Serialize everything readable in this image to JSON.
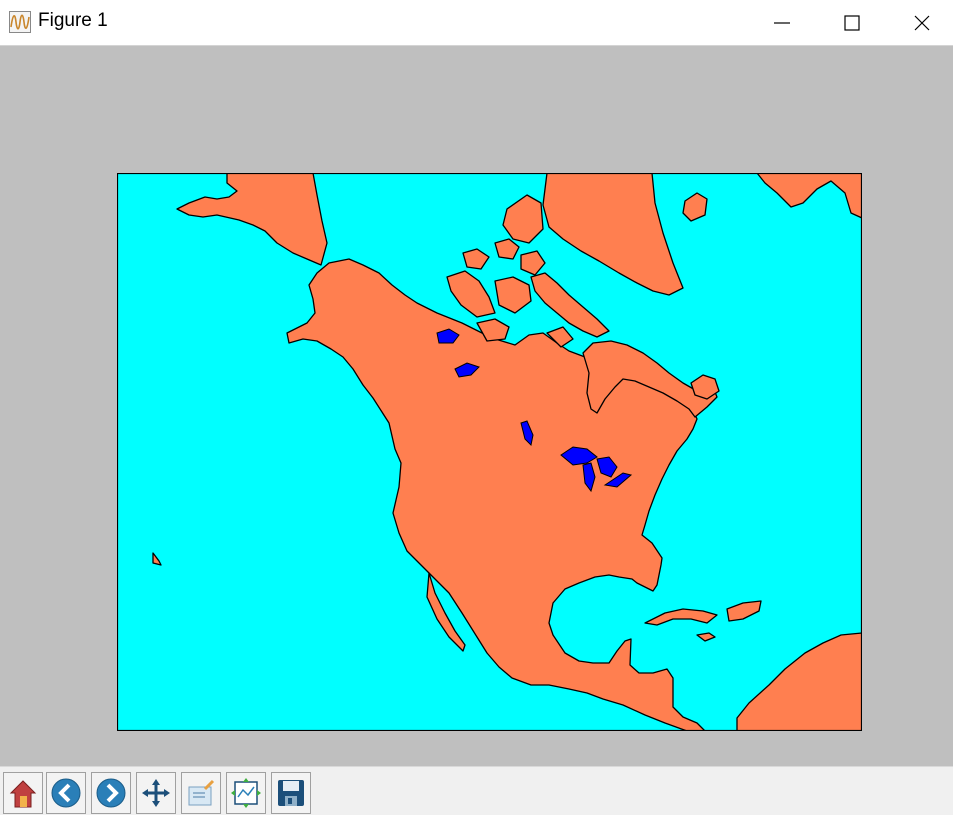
{
  "window": {
    "title": "Figure 1",
    "controls": [
      "minimize",
      "maximize",
      "close"
    ]
  },
  "figure": {
    "background_color": "#bfbfbf",
    "map": {
      "projection": "north-america-basemap",
      "ocean_color": "#00ffff",
      "land_color": "#ff7f50",
      "lake_color": "#0000ff",
      "coastline_color": "#000000"
    }
  },
  "toolbar": {
    "buttons": [
      {
        "name": "home",
        "icon": "home-icon"
      },
      {
        "name": "back",
        "icon": "back-arrow-icon"
      },
      {
        "name": "forward",
        "icon": "forward-arrow-icon"
      },
      {
        "name": "pan",
        "icon": "pan-arrows-icon"
      },
      {
        "name": "zoom",
        "icon": "zoom-rect-icon"
      },
      {
        "name": "subplots",
        "icon": "subplots-config-icon"
      },
      {
        "name": "save",
        "icon": "floppy-disk-icon"
      }
    ]
  }
}
